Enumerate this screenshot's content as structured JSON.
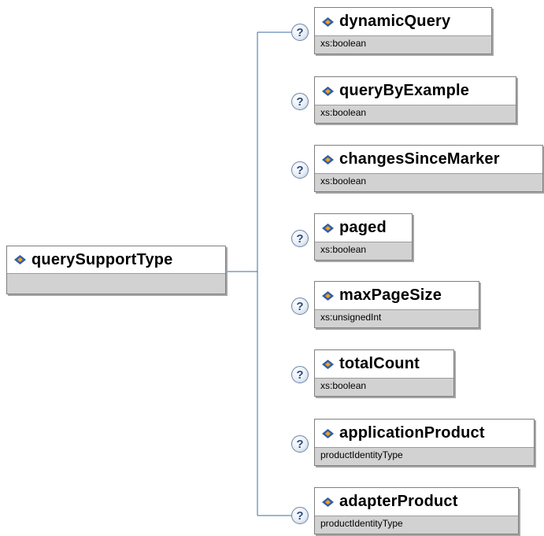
{
  "colors": {
    "connector": "#3a6ea5",
    "box_fill": "#d2d2d2",
    "box_border": "#7f7f7f",
    "gem_blue": "#2f5ea8",
    "gem_orange": "#f0a020",
    "badge_text": "#2c4a7c"
  },
  "icons": {
    "element": "element-gem-icon",
    "optional": "question-mark-icon"
  },
  "root": {
    "name": "querySupportType",
    "type": ""
  },
  "badge_symbol": "?",
  "elements": [
    {
      "name": "dynamicQuery",
      "type": "xs:boolean"
    },
    {
      "name": "queryByExample",
      "type": "xs:boolean"
    },
    {
      "name": "changesSinceMarker",
      "type": "xs:boolean"
    },
    {
      "name": "paged",
      "type": "xs:boolean"
    },
    {
      "name": "maxPageSize",
      "type": "xs:unsignedInt"
    },
    {
      "name": "totalCount",
      "type": "xs:boolean"
    },
    {
      "name": "applicationProduct",
      "type": "productIdentityType"
    },
    {
      "name": "adapterProduct",
      "type": "productIdentityType"
    }
  ]
}
